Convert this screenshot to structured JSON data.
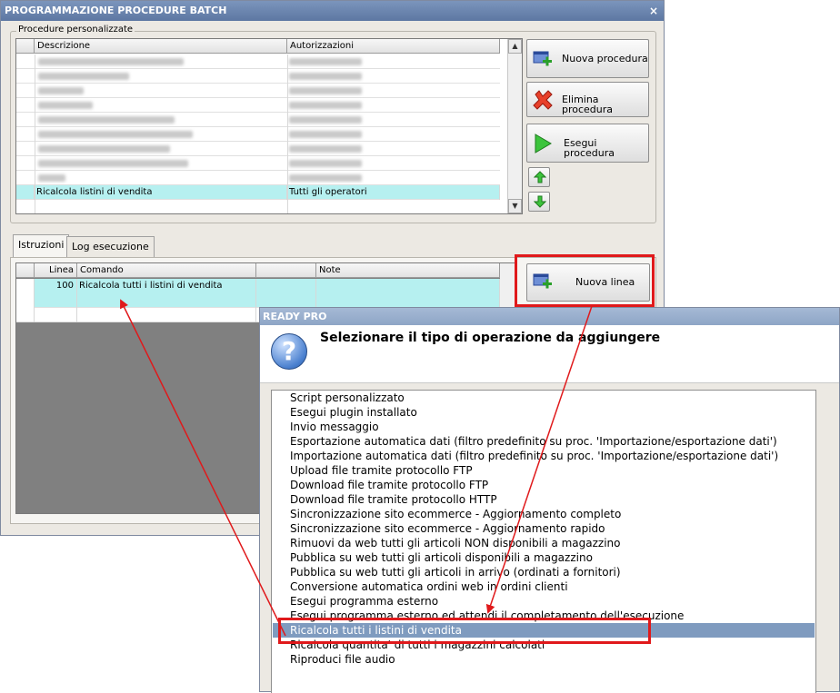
{
  "main_window": {
    "title": "PROGRAMMAZIONE PROCEDURE BATCH",
    "close_glyph": "×",
    "procedures_group_label": "Procedure personalizzate",
    "procedures_columns": [
      "Descrizione",
      "Autorizzazioni"
    ],
    "procedures_selected_row": {
      "description": "Ricalcola listini di vendita",
      "authorization": "Tutti gli operatori"
    },
    "buttons": {
      "new_procedure": "Nuova procedura",
      "delete_procedure": "Elimina procedura",
      "run_procedure": "Esegui procedura",
      "new_line": "Nuova linea"
    },
    "tabs": [
      "Istruzioni",
      "Log esecuzione"
    ],
    "lines_columns": [
      "Linea",
      "Comando",
      "",
      "Note"
    ],
    "lines_rows": [
      {
        "line": "100",
        "command": "Ricalcola tutti i listini di vendita",
        "note": ""
      }
    ]
  },
  "dialog": {
    "title": "READY PRO",
    "heading": "Selezionare il tipo di operazione da aggiungere",
    "question_glyph": "?",
    "selected_index": 16,
    "options": [
      "Script personalizzato",
      "Esegui plugin installato",
      "Invio messaggio",
      "Esportazione automatica dati (filtro predefinito su proc. 'Importazione/esportazione dati')",
      "Importazione automatica dati (filtro predefinito su proc. 'Importazione/esportazione dati')",
      "Upload file tramite protocollo FTP",
      "Download file tramite protocollo FTP",
      "Download file tramite protocollo HTTP",
      "Sincronizzazione sito ecommerce - Aggiornamento completo",
      "Sincronizzazione sito ecommerce - Aggiornamento rapido",
      "Rimuovi da web tutti gli articoli NON disponibili a magazzino",
      "Pubblica su web tutti gli articoli disponibili a magazzino",
      "Pubblica su web tutti gli articoli in arrivo (ordinati a fornitori)",
      "Conversione automatica ordini web in ordini clienti",
      "Esegui programma esterno",
      "Esegui programma esterno ed attendi il completamento dell'esecuzione",
      "Ricalcola tutti i listini di vendita",
      "Ricalcola quantita' di tutti i magazzini calcolati",
      "Riproduci file audio"
    ]
  },
  "colors": {
    "annotation_red": "#e0191b",
    "selection_cyan": "#b6f0f0",
    "list_selection": "#7f9bbf"
  },
  "icons": {
    "new_procedure": "add-window-icon",
    "delete_procedure": "red-x-icon",
    "run_procedure": "green-play-icon",
    "move_up": "green-up-arrow-icon",
    "move_down": "green-down-arrow-icon",
    "dialog": "question-icon"
  }
}
